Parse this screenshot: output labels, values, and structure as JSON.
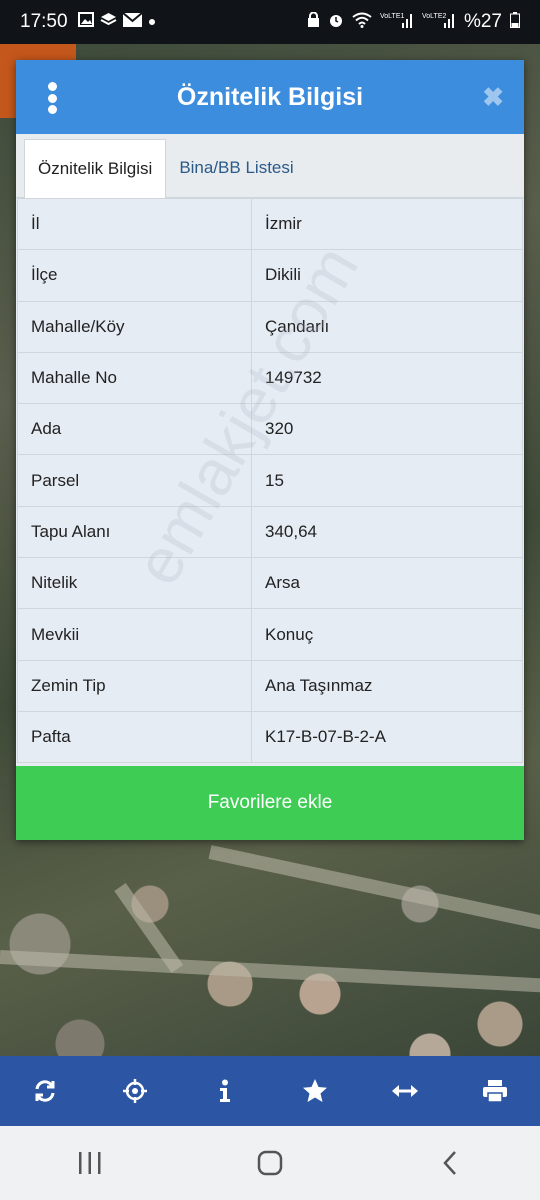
{
  "status_bar": {
    "time": "17:50",
    "battery": "%27",
    "network_label_1": "Vo))\nLTE1",
    "network_label_2": "Vo))\nLTE2"
  },
  "dialog": {
    "title": "Öznitelik Bilgisi",
    "tabs": [
      {
        "label": "Öznitelik Bilgisi",
        "active": true
      },
      {
        "label": "Bina/BB Listesi",
        "active": false
      }
    ],
    "rows": [
      {
        "key": "İl",
        "value": "İzmir"
      },
      {
        "key": "İlçe",
        "value": "Dikili"
      },
      {
        "key": "Mahalle/Köy",
        "value": "Çandarlı"
      },
      {
        "key": "Mahalle No",
        "value": "149732"
      },
      {
        "key": "Ada",
        "value": "320"
      },
      {
        "key": "Parsel",
        "value": "15"
      },
      {
        "key": "Tapu Alanı",
        "value": "340,64"
      },
      {
        "key": "Nitelik",
        "value": "Arsa"
      },
      {
        "key": "Mevkii",
        "value": "Konuç"
      },
      {
        "key": "Zemin Tip",
        "value": "Ana Taşınmaz"
      },
      {
        "key": "Pafta",
        "value": "K17-B-07-B-2-A"
      }
    ],
    "favorite_button": "Favorilere ekle"
  },
  "watermark": "emlakjet.com",
  "toolbar": {
    "tools": [
      "refresh-icon",
      "locate-icon",
      "info-icon",
      "star-icon",
      "measure-icon",
      "print-icon"
    ]
  },
  "colors": {
    "header": "#3d8ddf",
    "favorite": "#3fcc55",
    "toolbar": "#2c56a3"
  }
}
